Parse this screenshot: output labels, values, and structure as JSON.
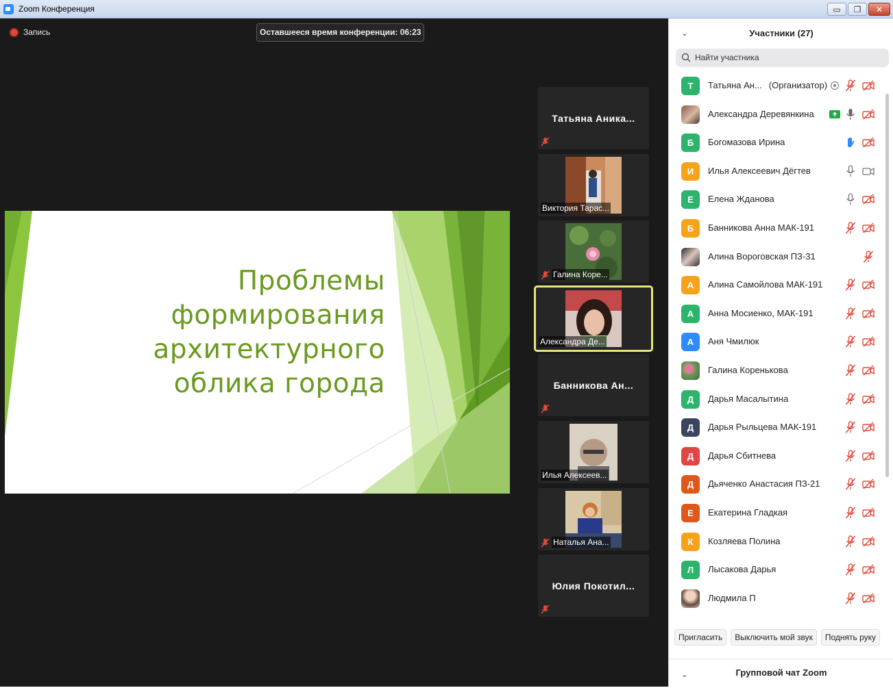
{
  "window": {
    "title": "Zoom Конференция",
    "minimize_glyph": "▭",
    "restore_glyph": "❐",
    "close_glyph": "✕"
  },
  "meeting": {
    "recording_label": "Запись",
    "time_left": "Оставшееся время конференции: 06:23"
  },
  "slide": {
    "title_lines": [
      "Проблемы",
      "формирования",
      "архитектурного",
      "облика города"
    ],
    "accent_color": "#6a9a20"
  },
  "thumbnails": [
    {
      "name": "Татьяна  Аника...",
      "style": "name-only",
      "muted": true
    },
    {
      "name": "Виктория Тарас...",
      "style": "video",
      "muted": false
    },
    {
      "name": "Галина Коре...",
      "style": "video",
      "muted": true
    },
    {
      "name": "Александра Де...",
      "style": "video",
      "muted": false,
      "active": true
    },
    {
      "name": "Банникова  Ан...",
      "style": "name-only",
      "muted": true
    },
    {
      "name": "Илья Алексеев...",
      "style": "video",
      "muted": false
    },
    {
      "name": "Наталья Ана...",
      "style": "video",
      "muted": true
    },
    {
      "name": "Юлия  Покотил...",
      "style": "name-only",
      "muted": true
    }
  ],
  "participants_panel": {
    "title": "Участники (27)",
    "collapse_glyph": "⌄",
    "search_placeholder": "Найти участника",
    "participants": [
      {
        "initial": "Т",
        "color": "#2cb36c",
        "name": "Татьяна Ан...",
        "role": "(Организатор)",
        "extra": "record",
        "mic": "muted",
        "cam": "off"
      },
      {
        "initial": "",
        "avatar": "photo",
        "name": "Александра Деревянкина",
        "extra": "share",
        "mic": "on",
        "cam": "off"
      },
      {
        "initial": "Б",
        "color": "#2cb36c",
        "name": "Богомазова Ирина",
        "extra": "",
        "mic": "hand",
        "cam": "off"
      },
      {
        "initial": "И",
        "color": "#f7a21b",
        "name": "Илья Алексеевич Дёгтев",
        "extra": "",
        "mic": "on-gray",
        "cam": "on-gray"
      },
      {
        "initial": "Е",
        "color": "#2cb36c",
        "name": "Елена Жданова",
        "extra": "",
        "mic": "on-gray",
        "cam": "off"
      },
      {
        "initial": "Б",
        "color": "#f7a21b",
        "name": " Банникова Анна МАК-191",
        "extra": "",
        "mic": "muted",
        "cam": "off"
      },
      {
        "initial": "",
        "avatar": "photo2",
        "name": "Алина Вороговская ПЗ-31",
        "extra": "",
        "mic": "none",
        "cam": "muted-mic"
      },
      {
        "initial": "А",
        "color": "#f7a21b",
        "name": "Алина Самойлова МАК-191",
        "extra": "",
        "mic": "muted",
        "cam": "off"
      },
      {
        "initial": "А",
        "color": "#2cb36c",
        "name": "Анна Мосиенко, МАК-191",
        "extra": "",
        "mic": "muted",
        "cam": "off"
      },
      {
        "initial": "А",
        "color": "#2d8cff",
        "name": "Аня Чмилюк",
        "extra": "",
        "mic": "muted",
        "cam": "off"
      },
      {
        "initial": "",
        "avatar": "photo3",
        "name": "Галина Кореньковa",
        "extra": "",
        "mic": "muted",
        "cam": "off"
      },
      {
        "initial": "Д",
        "color": "#2cb36c",
        "name": "Дарья Масалытина",
        "extra": "",
        "mic": "muted",
        "cam": "off"
      },
      {
        "initial": "Д",
        "color": "#3a4660",
        "name": "Дарья Рыльцева МАК-191",
        "extra": "",
        "mic": "muted",
        "cam": "off"
      },
      {
        "initial": "Д",
        "color": "#e04646",
        "name": "Дарья Сбитнева",
        "extra": "",
        "mic": "muted",
        "cam": "off"
      },
      {
        "initial": "Д",
        "color": "#e0571b",
        "name": "Дьяченко Анастасия ПЗ-21",
        "extra": "",
        "mic": "muted",
        "cam": "off"
      },
      {
        "initial": "Е",
        "color": "#e0571b",
        "name": "Екатерина Гладкая",
        "extra": "",
        "mic": "muted",
        "cam": "off"
      },
      {
        "initial": "К",
        "color": "#f7a21b",
        "name": "Козляева Полина",
        "extra": "",
        "mic": "muted",
        "cam": "off"
      },
      {
        "initial": "Л",
        "color": "#2cb36c",
        "name": "Лысакова Дарья",
        "extra": "",
        "mic": "muted",
        "cam": "off"
      },
      {
        "initial": "",
        "avatar": "photo4",
        "name": "Людмила П",
        "extra": "",
        "mic": "muted",
        "cam": "off"
      }
    ],
    "actions": {
      "invite": "Пригласить",
      "mute_me": "Выключить мой звук",
      "raise_hand": "Поднять руку"
    },
    "chat_title": "Групповой чат Zoom"
  }
}
